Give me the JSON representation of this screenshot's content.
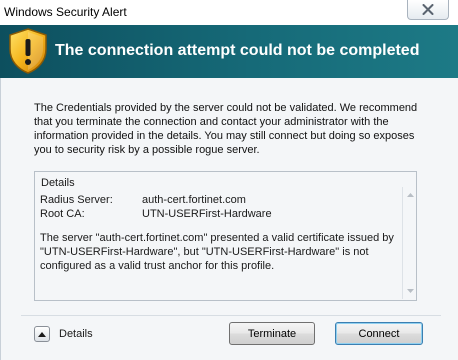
{
  "window": {
    "title": "Windows Security Alert"
  },
  "header": {
    "title": "The connection attempt could not be completed",
    "background": "#166a78"
  },
  "message": "The Credentials provided by the server could not be validated. We recommend that you terminate the connection and contact your administrator with the information provided in the details. You may still connect but doing so exposes you to security risk by a possible rogue server.",
  "details": {
    "legend": "Details",
    "fields": [
      {
        "key": "Radius Server:",
        "value": "auth-cert.fortinet.com"
      },
      {
        "key": "Root CA:",
        "value": "UTN-USERFirst-Hardware"
      }
    ],
    "text": "The server \"auth-cert.fortinet.com\" presented a valid certificate issued by \"UTN-USERFirst-Hardware\", but \"UTN-USERFirst-Hardware\" is not configured as a valid trust anchor for this profile."
  },
  "footer": {
    "details_toggle_label": "Details",
    "terminate_label": "Terminate",
    "connect_label": "Connect"
  },
  "icons": {
    "shield": "warning-shield-icon",
    "close": "close-icon",
    "toggle": "chevron-up-icon"
  }
}
